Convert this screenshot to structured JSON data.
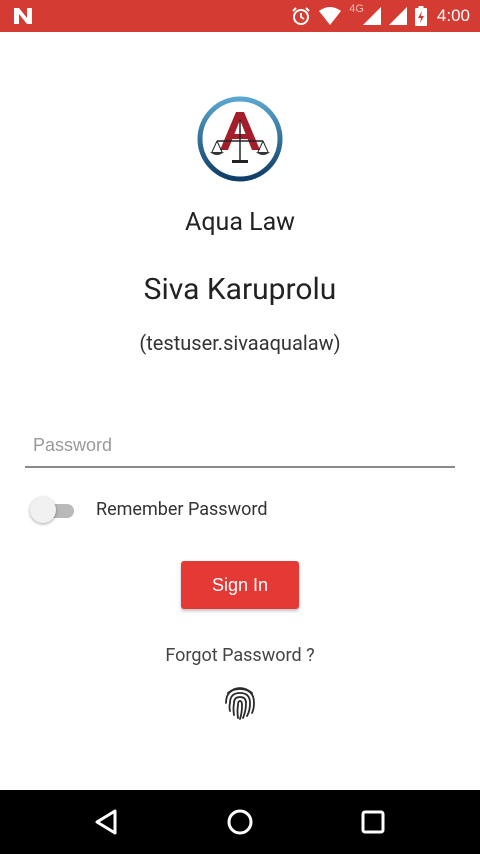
{
  "status_bar": {
    "time": "4:00",
    "network": "4G",
    "background": "#d43b33",
    "icons": [
      "n-icon",
      "alarm-icon",
      "wifi-icon",
      "signal-icon",
      "signal-icon",
      "battery-charging-icon"
    ]
  },
  "logo": {
    "icon": "aqua-law-logo-icon",
    "letter": "A"
  },
  "app_name": "Aqua Law",
  "user": {
    "name": "Siva Karuprolu",
    "username": "(testuser.sivaaqualaw)"
  },
  "password": {
    "placeholder": "Password",
    "value": ""
  },
  "remember": {
    "label": "Remember Password",
    "checked": false
  },
  "sign_in": {
    "label": "Sign In",
    "color": "#e53935"
  },
  "forgot_password": "Forgot Password ?",
  "fingerprint_icon": "fingerprint-icon",
  "nav_bar": {
    "buttons": [
      "back-icon",
      "home-icon",
      "recents-icon"
    ]
  }
}
